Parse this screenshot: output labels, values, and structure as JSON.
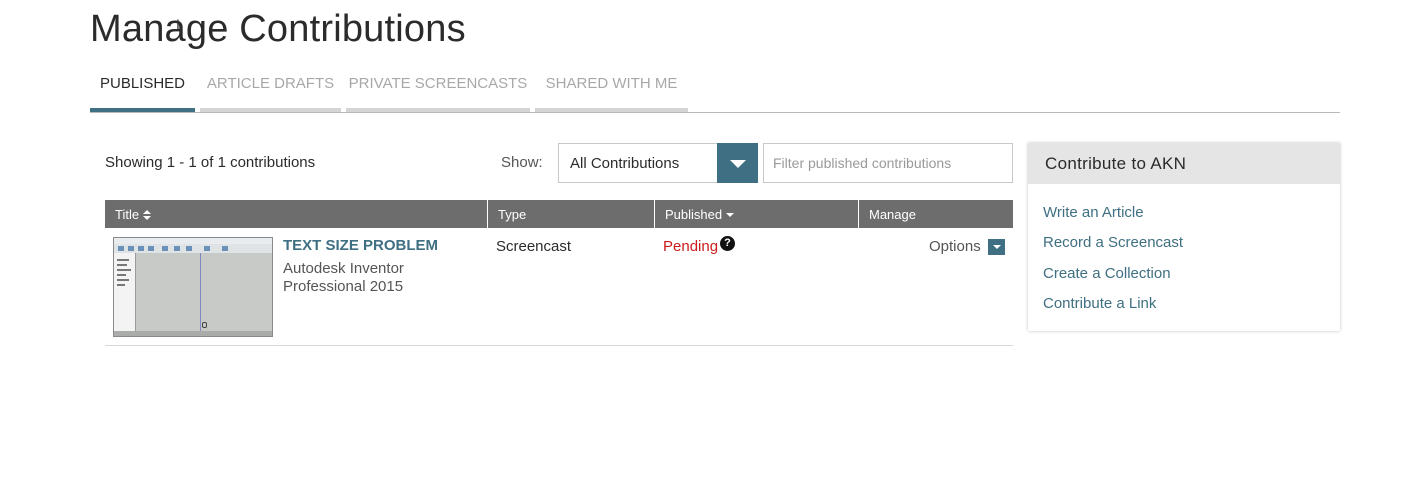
{
  "page": {
    "title": "Manage Contributions"
  },
  "tabs": [
    {
      "label": "PUBLISHED",
      "active": true
    },
    {
      "label": "ARTICLE DRAFTS",
      "active": false
    },
    {
      "label": "PRIVATE SCREENCASTS",
      "active": false
    },
    {
      "label": "SHARED WITH ME",
      "active": false
    }
  ],
  "toolbar": {
    "showing": "Showing 1 - 1 of 1 contributions",
    "show_label": "Show:",
    "select_value": "All Contributions",
    "filter_placeholder": "Filter published contributions"
  },
  "table": {
    "columns": [
      "Title",
      "Type",
      "Published",
      "Manage"
    ],
    "rows": [
      {
        "title": "TEXT SIZE PROBLEM",
        "product": "Autodesk Inventor Professional 2015",
        "type": "Screencast",
        "status": "Pending",
        "manage": "Options"
      }
    ]
  },
  "sidebar": {
    "title": "Contribute to AKN",
    "links": [
      "Write an Article",
      "Record a Screencast",
      "Create a Collection",
      "Contribute a Link"
    ]
  },
  "colors": {
    "accent": "#3f6f82",
    "header_gray": "#6d6d6d",
    "pending_red": "#cc1b1b"
  },
  "icons": {
    "help": "question-circle-icon",
    "dropdown": "caret-down-icon",
    "sort": "sort-icon"
  }
}
